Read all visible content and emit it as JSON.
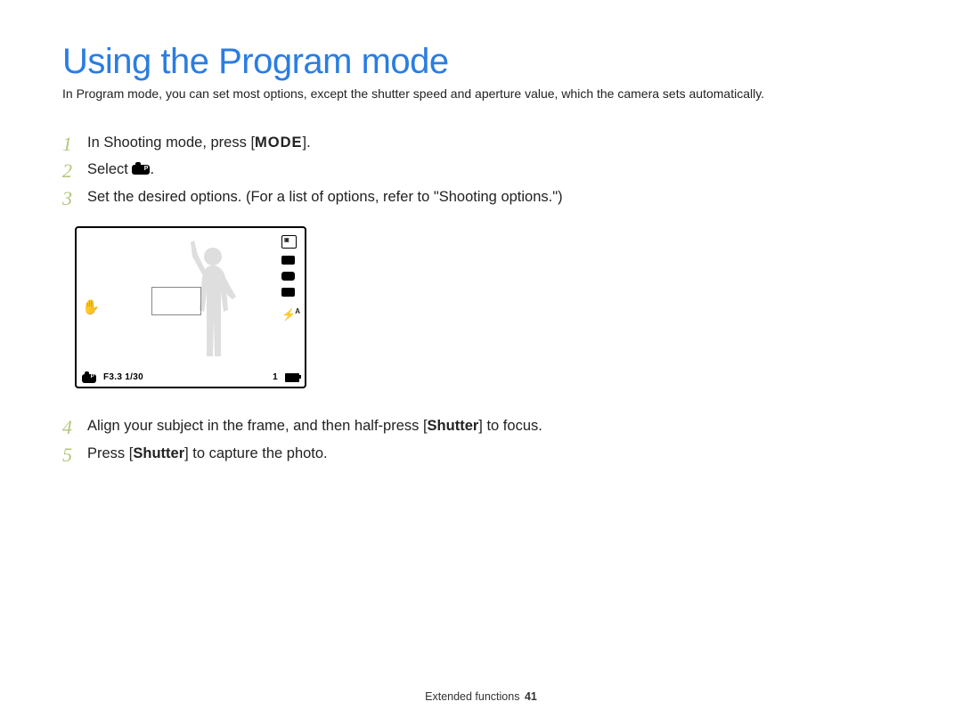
{
  "title": "Using the Program mode",
  "intro": "In Program mode, you can set most options, except the shutter speed and aperture value, which the camera sets automatically.",
  "steps": [
    {
      "num": "1",
      "pre": "In Shooting mode, press [",
      "label": "MODE",
      "post": "]."
    },
    {
      "num": "2",
      "pre": "Select ",
      "post": "."
    },
    {
      "num": "3",
      "text": "Set the desired options. (For a list of options, refer to \"Shooting options.\")"
    },
    {
      "num": "4",
      "pre": "Align your subject in the frame, and then half-press [",
      "bold": "Shutter",
      "post": "] to focus."
    },
    {
      "num": "5",
      "pre": "Press [",
      "bold": "Shutter",
      "post": "] to capture the photo."
    }
  ],
  "lcd": {
    "exposure": "F3.3 1/30",
    "counter": "1",
    "flash": "⚡ᴬ"
  },
  "footer": {
    "section": "Extended functions",
    "page": "41"
  }
}
